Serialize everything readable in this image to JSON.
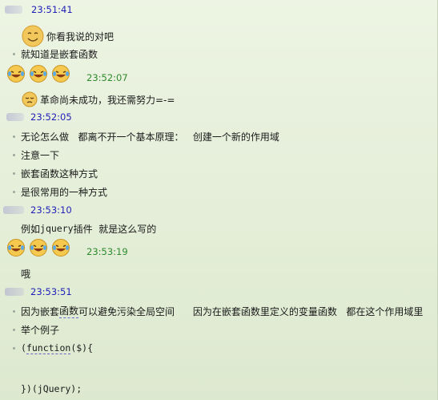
{
  "messages": [
    {
      "ts": "23:51:41"
    },
    {
      "text": "你看我说的对吧"
    },
    {
      "text": "就知道是嵌套函数"
    },
    {
      "ts": "23:52:07"
    },
    {
      "text": "革命尚未成功，我还需努力=-="
    },
    {
      "ts": "23:52:05"
    },
    {
      "text": "无论怎么做   都离不开一个基本原理：   创建一个新的作用域"
    },
    {
      "text": "注意一下"
    },
    {
      "text": "嵌套函数这种方式"
    },
    {
      "text": "是很常用的一种方式"
    },
    {
      "ts": "23:53:10"
    },
    {
      "text_a": "例如",
      "text_b": "jquery",
      "text_c": "插件  就是这么写的"
    },
    {
      "ts": "23:53:19"
    },
    {
      "text": "哦"
    },
    {
      "ts": "23:53:51"
    },
    {
      "text_a": "因为嵌套",
      "text_b": "函数",
      "text_c": "可以避免污染全局空间      因为在嵌套函数里定义的变量函数   都在这个作用域里"
    },
    {
      "text": "举个例子"
    },
    {
      "text_a": "(",
      "text_b": "function",
      "text_c": "($){"
    },
    {
      "text": "})(jQuery);"
    }
  ],
  "colors": {
    "ts_blue": "#1f1fb8",
    "ts_green": "#2d8a2d",
    "background": "#e6efdb"
  },
  "icons": {
    "smile": "smiling-face-emoji",
    "laugh": "laughing-tears-emoji",
    "sad": "pensive-face-emoji"
  }
}
